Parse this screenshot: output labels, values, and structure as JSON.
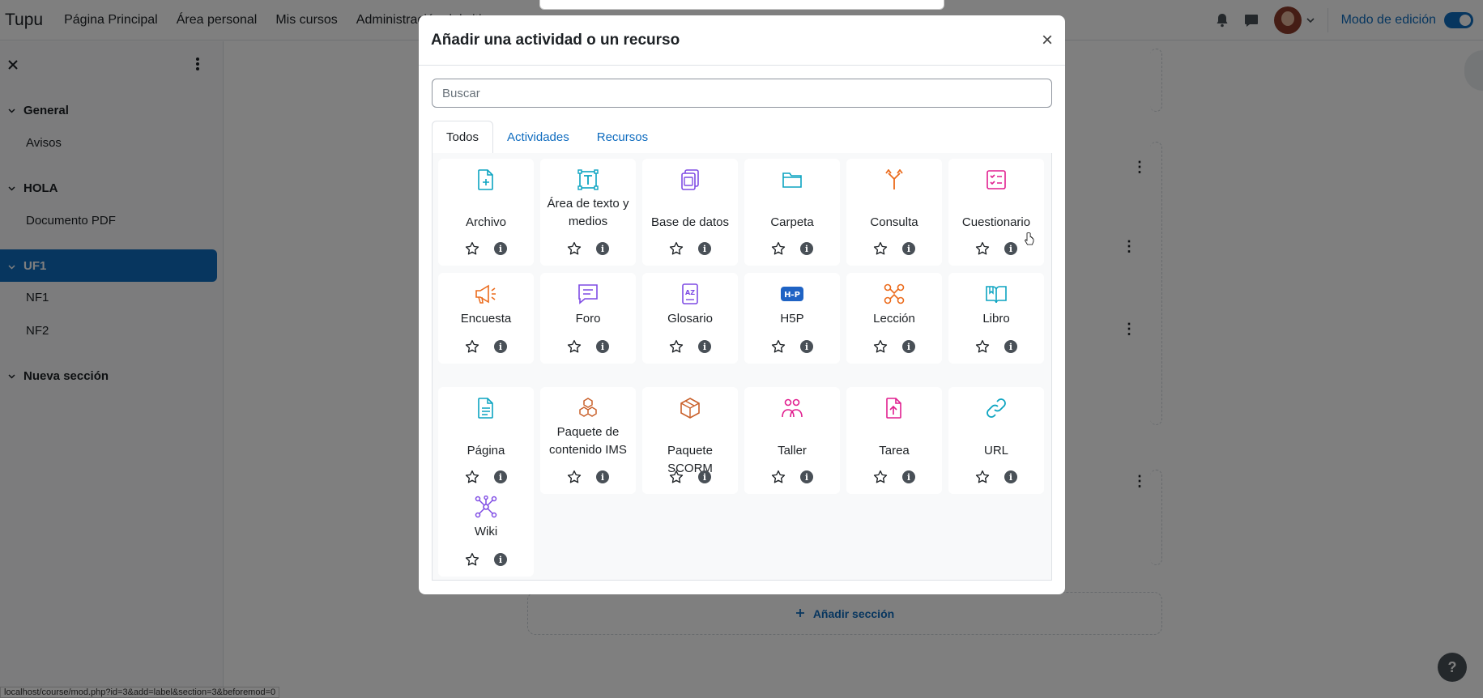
{
  "topbar": {
    "brand": "Tupu",
    "nav": [
      "Página Principal",
      "Área personal",
      "Mis cursos",
      "Administración del sitio"
    ],
    "edit_mode_label": "Modo de edición"
  },
  "drawer": {
    "sections": [
      {
        "title": "General",
        "items": [
          "Avisos"
        ]
      },
      {
        "title": "HOLA",
        "items": [
          "Documento PDF"
        ]
      },
      {
        "title": "UF1",
        "items": [
          "NF1",
          "NF2"
        ]
      },
      {
        "title": "Nueva sección",
        "items": []
      }
    ]
  },
  "page": {
    "add_section_label": "Añadir sección",
    "help_label": "?",
    "status_url": "localhost/course/mod.php?id=3&add=label&section=3&beforemod=0"
  },
  "modal": {
    "title": "Añadir una actividad o un recurso",
    "close_symbol": "×",
    "search_placeholder": "Buscar",
    "search_value": "",
    "tabs": [
      "Todos",
      "Actividades",
      "Recursos"
    ],
    "active_tab": "Todos",
    "info_symbol": "i",
    "items": [
      {
        "name": "Archivo",
        "icon": "file-icon",
        "color": "#0ca4c1"
      },
      {
        "name": "Área de texto y medios",
        "icon": "text-media-icon",
        "color": "#0ca4c1"
      },
      {
        "name": "Base de datos",
        "icon": "database-icon",
        "color": "#7f4ce4"
      },
      {
        "name": "Carpeta",
        "icon": "folder-icon",
        "color": "#0ca4c1"
      },
      {
        "name": "Consulta",
        "icon": "choice-icon",
        "color": "#eb6b1c"
      },
      {
        "name": "Cuestionario",
        "icon": "quiz-icon",
        "color": "#e11f8f"
      },
      {
        "name": "Encuesta",
        "icon": "feedback-icon",
        "color": "#eb6b1c"
      },
      {
        "name": "Foro",
        "icon": "forum-icon",
        "color": "#7f4ce4"
      },
      {
        "name": "Glosario",
        "icon": "glossary-icon",
        "color": "#7f4ce4"
      },
      {
        "name": "H5P",
        "icon": "h5p-icon",
        "color": "#1f63c4"
      },
      {
        "name": "Lección",
        "icon": "lesson-icon",
        "color": "#eb6b1c"
      },
      {
        "name": "Libro",
        "icon": "book-icon",
        "color": "#0ca4c1"
      },
      {
        "name": "Página",
        "icon": "page-icon",
        "color": "#0ca4c1"
      },
      {
        "name": "Paquete de contenido IMS",
        "icon": "ims-package-icon",
        "color": "#c9602a"
      },
      {
        "name": "Paquete SCORM",
        "icon": "scorm-package-icon",
        "color": "#c9602a"
      },
      {
        "name": "Taller",
        "icon": "workshop-icon",
        "color": "#e11f8f"
      },
      {
        "name": "Tarea",
        "icon": "assignment-icon",
        "color": "#e11f8f"
      },
      {
        "name": "URL",
        "icon": "url-icon",
        "color": "#0ca4c1"
      },
      {
        "name": "Wiki",
        "icon": "wiki-icon",
        "color": "#7f4ce4"
      }
    ]
  }
}
